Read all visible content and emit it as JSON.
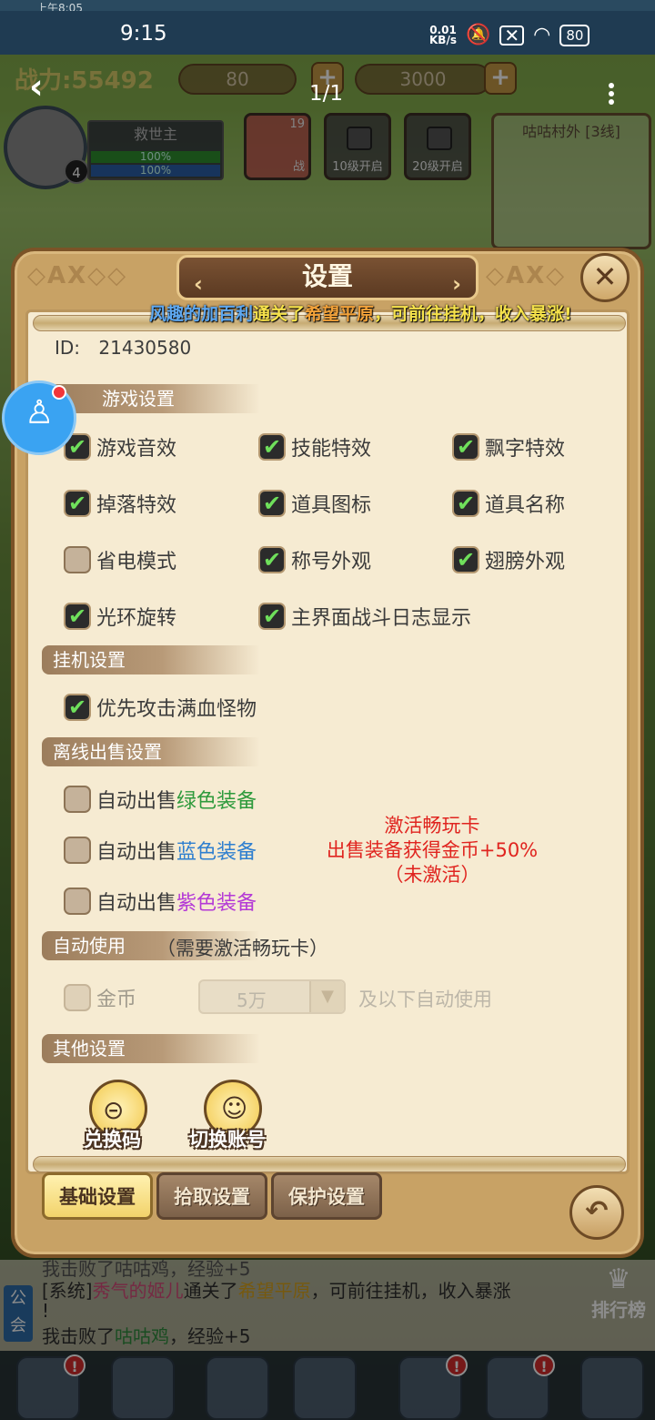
{
  "system": {
    "top_strip": "上午8:05",
    "time": "9:15",
    "net_speed_value": "0.01",
    "net_speed_unit": "KB/s",
    "battery": "80"
  },
  "viewer": {
    "page_count": "1/1"
  },
  "hud": {
    "power": "战力:55492",
    "diamonds": "80",
    "gold": "3000",
    "player_name": "救世主",
    "player_level": "4",
    "hp_pct": "100%",
    "mp_pct": "100%",
    "pet_level": "19",
    "pet_tag": "战",
    "slot1": "10级开启",
    "slot2": "20级开启",
    "map_name": "咕咕村外 [3线]"
  },
  "dialog": {
    "title": "设置",
    "marquee": {
      "p1": "风趣的加百利",
      "p2": "通关了",
      "p3": "希望平原",
      "p4": "，可前往挂机，收入暴涨!"
    },
    "id_label": "ID:",
    "id_value": "21430580",
    "sections": {
      "game": "游戏设置",
      "idle": "挂机设置",
      "offline": "离线出售设置",
      "auto_use": "自动使用",
      "auto_use_note": "（需要激活畅玩卡）",
      "other": "其他设置"
    },
    "game_options": {
      "sound": "游戏音效",
      "skill_fx": "技能特效",
      "float_text": "飘字特效",
      "drop_fx": "掉落特效",
      "item_icon": "道具图标",
      "item_name": "道具名称",
      "power_save": "省电模式",
      "title_look": "称号外观",
      "wing_look": "翅膀外观",
      "halo_rotate": "光环旋转",
      "battle_log": "主界面战斗日志显示"
    },
    "idle_options": {
      "attack_full_hp": "优先攻击满血怪物"
    },
    "offline_options": {
      "prefix": "自动出售",
      "green": "绿色装备",
      "blue": "蓝色装备",
      "purple": "紫色装备"
    },
    "promo": {
      "line1": "激活畅玩卡",
      "line2": "出售装备获得金币+50%",
      "line3": "（未激活）"
    },
    "auto_use_row": {
      "coin": "金币",
      "amount": "5万",
      "suffix": "及以下自动使用"
    },
    "other_buttons": {
      "redeem": "兑换码",
      "switch_account": "切换账号"
    },
    "tabs": {
      "basic": "基础设置",
      "pickup": "拾取设置",
      "protect": "保护设置"
    }
  },
  "chat": {
    "line0": "我击败了咕咕鸡，经验+5",
    "line1": {
      "tag": "[系统]",
      "name": "秀气的姬儿",
      "verb": "通关了",
      "place": "希望平原",
      "rest": "，可前往挂机，收入暴涨"
    },
    "line2": "!",
    "line3": {
      "pre": "我击败了",
      "mob": "咕咕鸡",
      "rest": "，经验+5"
    },
    "guild": "公会",
    "rank": "排行榜"
  },
  "colors": {
    "checked": "#6fe05b",
    "green_gear": "#2e9a3c",
    "blue_gear": "#2f7fcf",
    "purple_gear": "#b43ad6",
    "promo": "#e0241f"
  }
}
